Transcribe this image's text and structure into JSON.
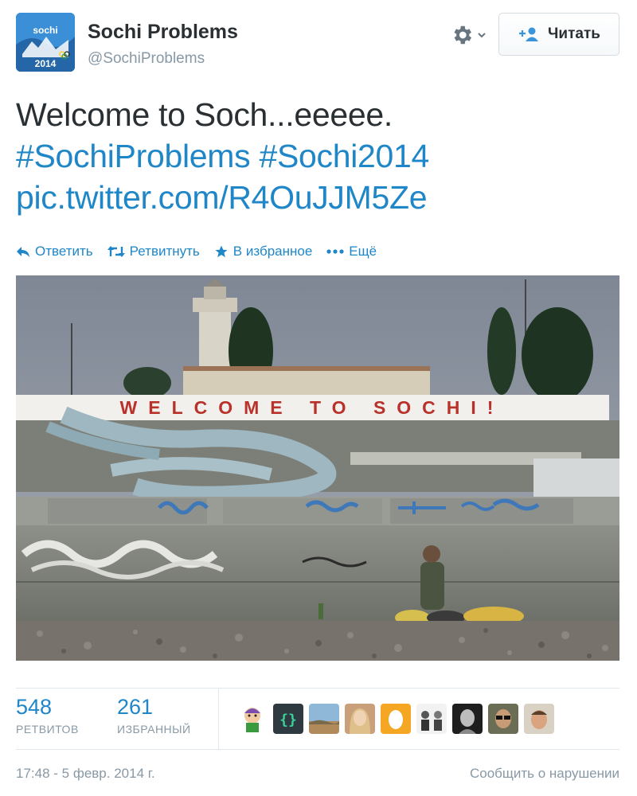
{
  "header": {
    "display_name": "Sochi Problems",
    "handle": "@SochiProblems",
    "avatar_icon": "sochi-2014-logo",
    "avatar_text": "sochi.ru 2014",
    "gear_icon": "gear-icon",
    "follow_label": "Читать",
    "follow_icon": "add-user-icon"
  },
  "tweet": {
    "text_line1": "Welcome to Soch...eeeee.",
    "hashtag1": "#SochiProblems",
    "hashtag2": "#Sochi2014",
    "link": "pic.twitter.com/R4OuJJM5Ze"
  },
  "actions": {
    "reply": "Ответить",
    "retweet": "Ретвитнуть",
    "favorite": "В избранное",
    "more": "Ещё"
  },
  "photo": {
    "sign_text": "WELCOME TO SOCHI!"
  },
  "stats": {
    "retweets_count": "548",
    "retweets_label": "РЕТВИТОВ",
    "favorites_count": "261",
    "favorites_label": "ИЗБРАННЫЙ",
    "favoriters": [
      "cartoon-avatar",
      "braces-avatar",
      "landscape-avatar",
      "portrait-avatar",
      "egg-avatar",
      "group-avatar",
      "bw-portrait-avatar",
      "sunglasses-avatar",
      "face-avatar"
    ]
  },
  "footer": {
    "timestamp": "17:48 - 5 февр. 2014 г.",
    "report": "Сообщить о нарушении"
  },
  "colors": {
    "link": "#1f86c8",
    "text": "#292f33",
    "muted": "#8899a6"
  }
}
